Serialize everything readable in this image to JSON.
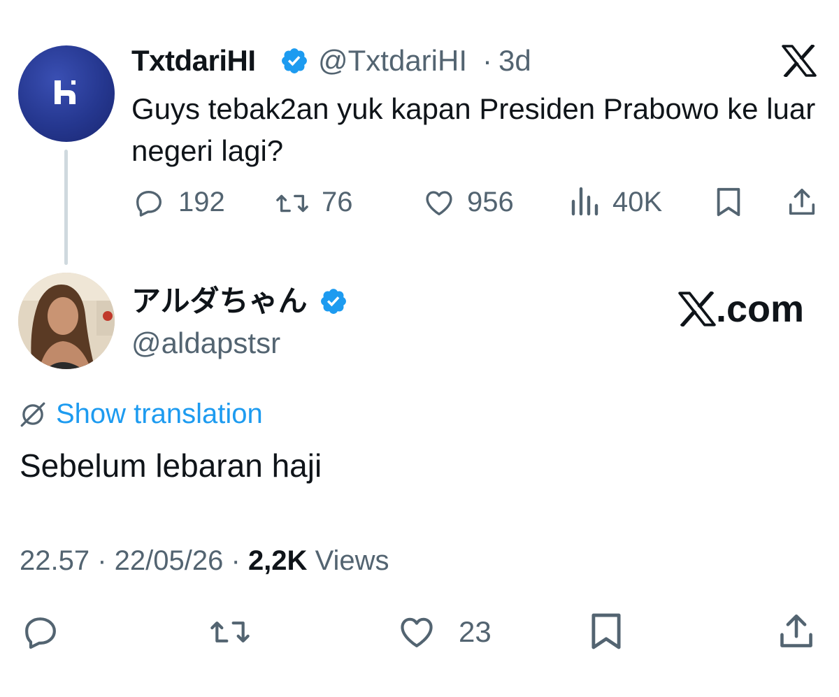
{
  "parent_tweet": {
    "display_name": "TxtdariHI",
    "handle": "@TxtdariHI",
    "separator": "·",
    "time_ago": "3d",
    "text": "Guys tebak2an yuk kapan Presiden Prabowo ke luar negeri lagi?",
    "avatar_icon": "letter-h-logo",
    "stats": {
      "replies": "192",
      "reposts": "76",
      "likes": "956",
      "views": "40K"
    }
  },
  "reply_tweet": {
    "display_name": "アルダちゃん",
    "handle": "@aldapstsr",
    "watermark": ".com",
    "translate_label": "Show translation",
    "text": "Sebelum lebaran haji",
    "time": "22.57",
    "date": "22/05/26",
    "view_count": "2,2K",
    "views_label": "Views",
    "likes": "23"
  },
  "colors": {
    "text_primary": "#0f1419",
    "text_secondary": "#536471",
    "accent": "#1d9bf0",
    "verified": "#1d9bf0"
  }
}
